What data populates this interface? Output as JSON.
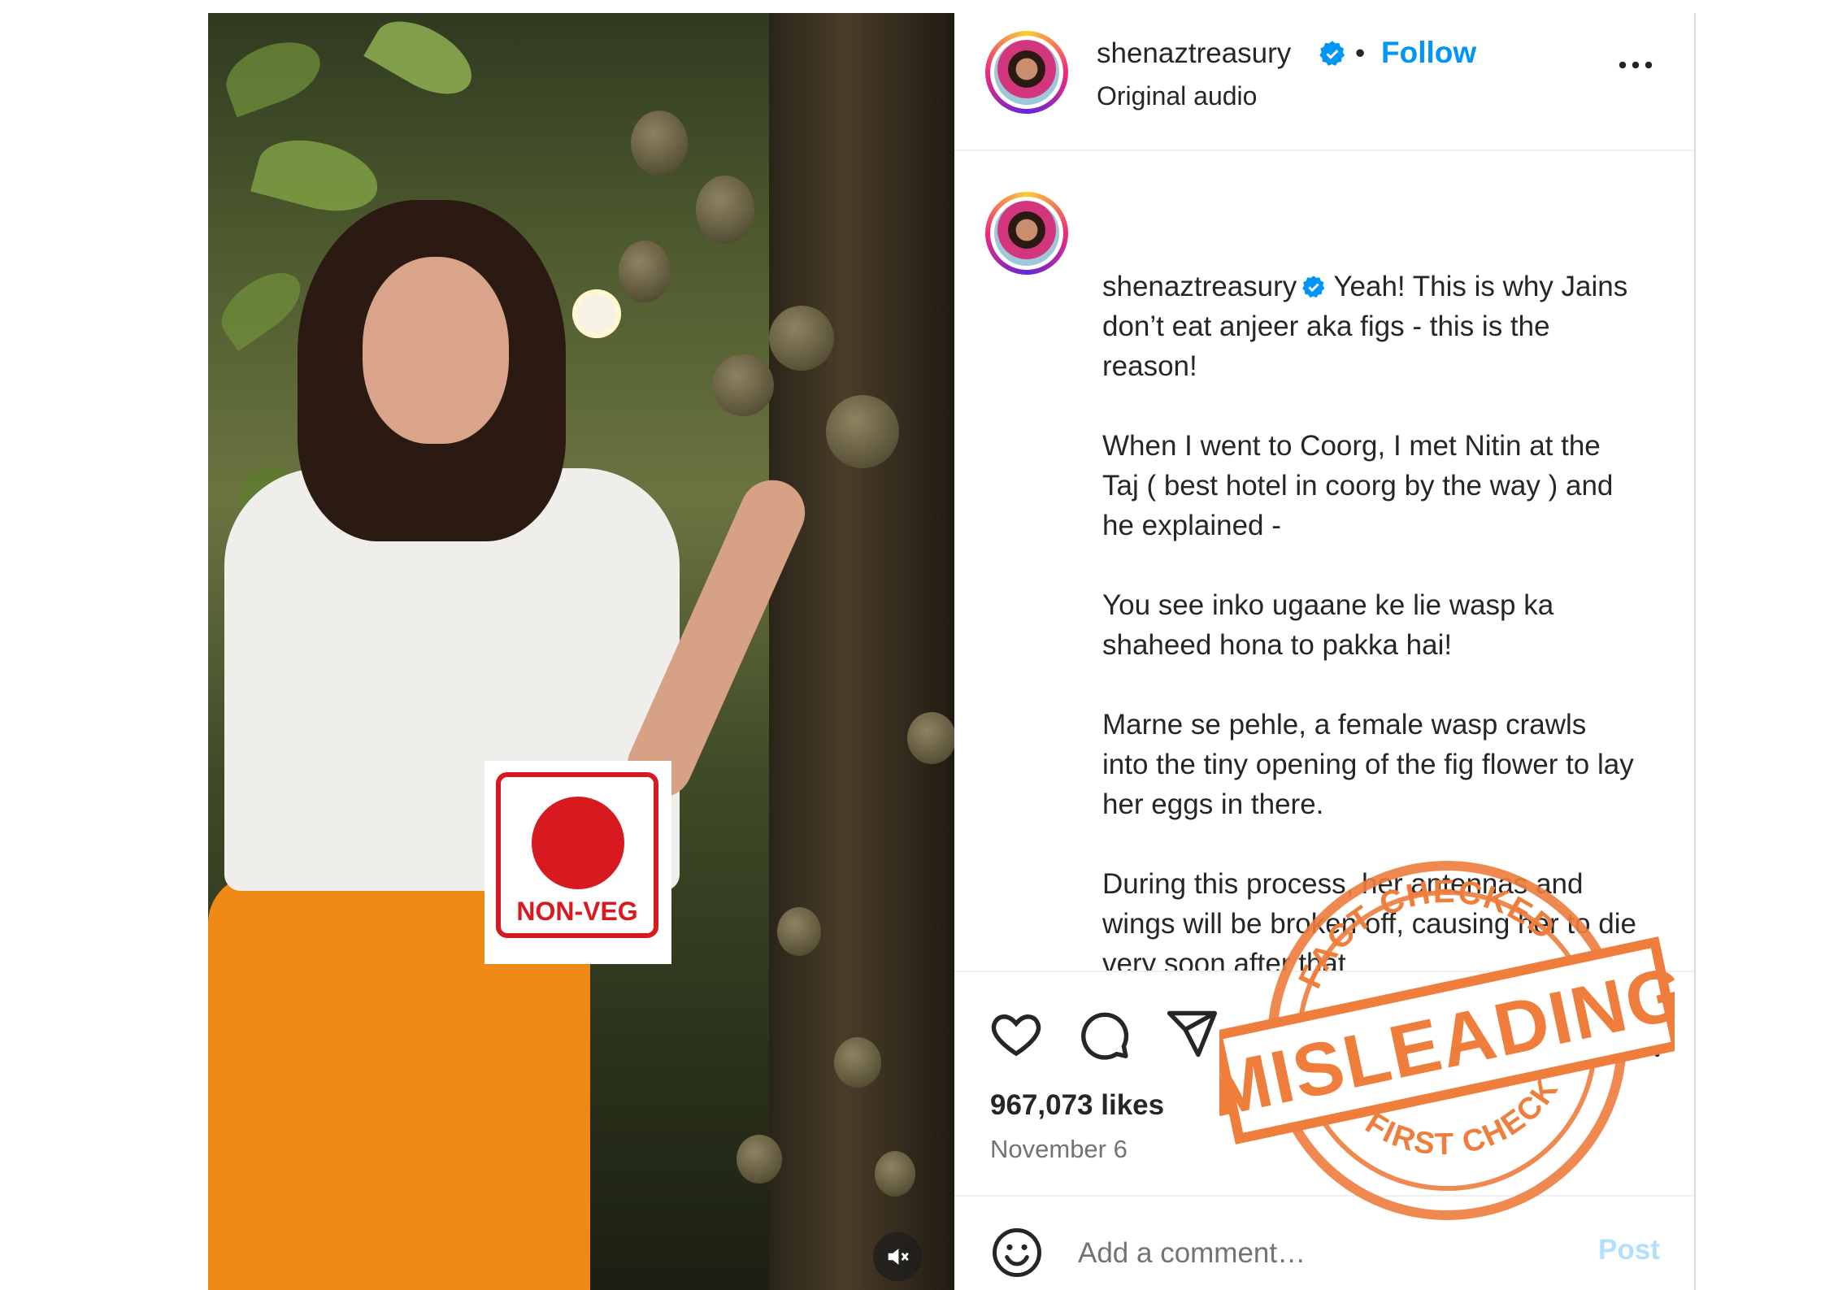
{
  "media": {
    "badge_text": "NON-VEG",
    "colors": {
      "badge_red": "#d71920"
    },
    "mute_icon": "speaker-muted-icon"
  },
  "post_header": {
    "username": "shenaztreasury",
    "separator": "•",
    "follow_label": "Follow",
    "subtitle": "Original audio",
    "more_icon": "more-horizontal-icon"
  },
  "caption": {
    "username": "shenaztreasury",
    "text": " Yeah! This is why Jains don’t eat anjeer aka figs - this is the reason!\n\nWhen I went to Coorg, I met Nitin at the Taj ( best hotel in coorg by the way ) and he explained -\n\nYou see inko ugaane ke lie wasp ka shaheed hona to pakka hai!\n\nMarne se pehle, a female wasp crawls into the tiny opening of the fig flower to lay her eggs in there.\n\nDuring this process, her antennas and wings will be broken off, causing her to die very soon after that\n\nYour lovely fruit, then digests, ho"
  },
  "actions": {
    "icons": [
      "heart-icon",
      "comment-icon",
      "share-icon",
      "bookmark-icon"
    ],
    "likes": "967,073 likes",
    "date": "November 6"
  },
  "comment_box": {
    "placeholder": "Add a comment…",
    "post_label": "Post",
    "emoji_icon": "emoji-icon"
  },
  "stamp": {
    "top_text": "FACT CHECKED",
    "main_text": "MISLEADING",
    "bottom_text": "FIRST CHECK",
    "color": "#ef7d3c"
  },
  "colors": {
    "link_blue": "#0095f6",
    "text_primary": "#262626",
    "text_secondary": "#737373",
    "post_disabled": "#b2dffc"
  }
}
